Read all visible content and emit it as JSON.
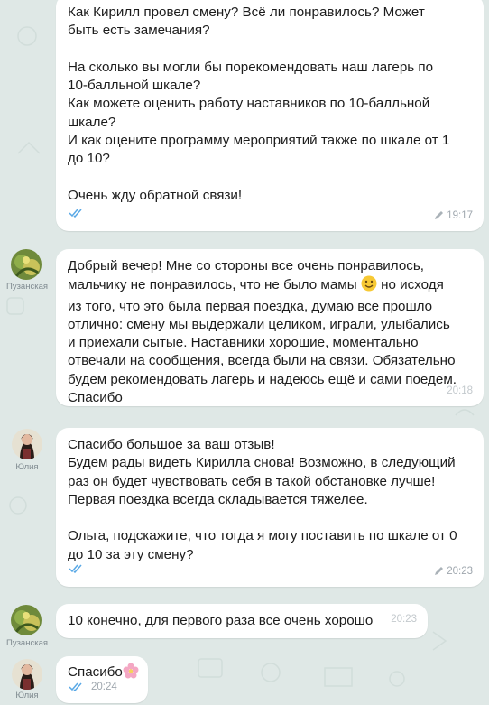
{
  "messages": [
    {
      "text": "Как Кирилл провел смену? Всё ли понравилось? Может\nбыть есть замечания?\n\nНа сколько вы могли бы порекомендовать наш лагерь по\n10-балльной шкале?\nКак можете оценить работу наставников по 10-балльной\nшкале?\nИ как оцените программу мероприятий также по шкале от 1\nдо 10?\n\nОчень жду обратной связи!",
      "time": "19:17",
      "edited": true,
      "read": true
    },
    {
      "sender": "Пузанская",
      "text_part1": "Добрый вечер! Мне со стороны все очень понравилось,\nмальчику не понравилось, что не было мамы ",
      "emoji": "smiling-face-emoji",
      "text_part2": " но исходя\nиз того, что это была первая поездка, думаю все прошло\nотлично: смену мы выдержали целиком, играли, улыбались\nи приехали сытые. Наставники хорошие, моментально\nотвечали на сообщения, всегда были на связи. Обязательно\nбудем рекомендовать лагерь и надеюсь ещё и сами поедем.\nСпасибо",
      "time": "20:18"
    },
    {
      "sender": "Юлия",
      "text": "Спасибо большое за ваш отзыв!\nБудем рады видеть Кирилла снова! Возможно, в следующий\nраз он будет чувствовать себя в такой обстановке лучше!\nПервая поездка всегда складывается тяжелее.\n\nОльга, подскажите, что тогда я могу поставить по шкале от 0\nдо 10 за эту смену?",
      "time": "20:23",
      "edited": true,
      "read": true
    },
    {
      "sender": "Пузанская",
      "text": "10 конечно, для первого раза все очень хорошо",
      "time": "20:23"
    },
    {
      "sender": "Юлия",
      "text": "Спасибо",
      "emoji": "cherry-blossom-emoji",
      "time": "20:24",
      "read": true
    }
  ],
  "colors": {
    "background": "#dfe8e6",
    "bubble": "#ffffff",
    "check": "#5aa9e6",
    "meta": "#9fa7ae"
  }
}
